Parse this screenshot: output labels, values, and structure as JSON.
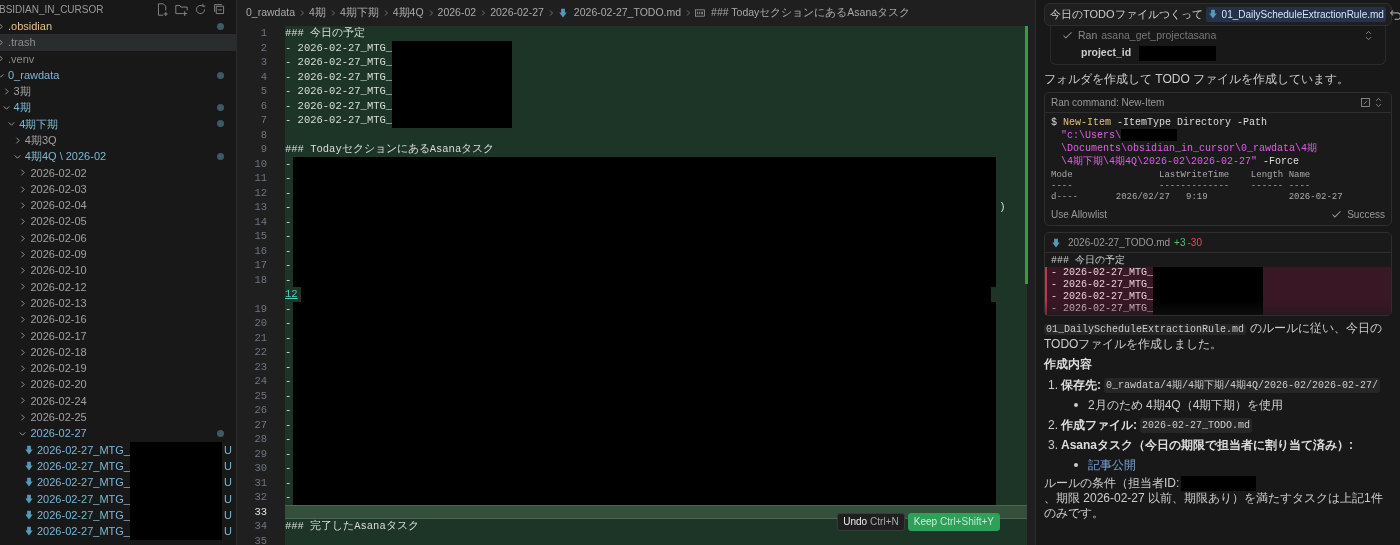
{
  "explorer": {
    "title": "BSIDIAN_IN_CURSOR",
    "tree": [
      {
        "name": ".obsidian",
        "kind": "folder",
        "expanded": false,
        "selected": false,
        "color": "#e2c08d",
        "modified": true
      },
      {
        "name": ".trash",
        "kind": "folder",
        "expanded": false,
        "selected": true,
        "color": "#8c8c8c",
        "modified": false
      },
      {
        "name": ".venv",
        "kind": "folder",
        "expanded": false,
        "selected": false,
        "color": "#8c8c8c",
        "modified": false
      },
      {
        "name": "0_rawdata",
        "kind": "folder",
        "expanded": true,
        "selected": false,
        "color": "#7ab8d6",
        "modified": true,
        "children": [
          {
            "name": "3期",
            "kind": "folder",
            "expanded": false,
            "selected": false,
            "color": "#a0a0a0",
            "modified": false
          },
          {
            "name": "4期",
            "kind": "folder",
            "expanded": true,
            "selected": false,
            "color": "#7ab8d6",
            "modified": true,
            "children": [
              {
                "name": "4期下期",
                "kind": "folder",
                "expanded": true,
                "selected": false,
                "color": "#7ab8d6",
                "modified": true,
                "children": [
                  {
                    "name": "4期3Q",
                    "kind": "folder",
                    "expanded": false,
                    "selected": false,
                    "color": "#a0a0a0",
                    "modified": false
                  },
                  {
                    "name": "4期4Q \\ 2026-02",
                    "kind": "folder",
                    "expanded": true,
                    "selected": false,
                    "color": "#7ab8d6",
                    "modified": true,
                    "children": [
                      {
                        "name": "2026-02-02",
                        "kind": "folder",
                        "expanded": false,
                        "selected": false,
                        "color": "#a0a0a0",
                        "modified": false
                      },
                      {
                        "name": "2026-02-03",
                        "kind": "folder",
                        "expanded": false,
                        "selected": false,
                        "color": "#a0a0a0",
                        "modified": false
                      },
                      {
                        "name": "2026-02-04",
                        "kind": "folder",
                        "expanded": false,
                        "selected": false,
                        "color": "#a0a0a0",
                        "modified": false
                      },
                      {
                        "name": "2026-02-05",
                        "kind": "folder",
                        "expanded": false,
                        "selected": false,
                        "color": "#a0a0a0",
                        "modified": false
                      },
                      {
                        "name": "2026-02-06",
                        "kind": "folder",
                        "expanded": false,
                        "selected": false,
                        "color": "#a0a0a0",
                        "modified": false
                      },
                      {
                        "name": "2026-02-09",
                        "kind": "folder",
                        "expanded": false,
                        "selected": false,
                        "color": "#a0a0a0",
                        "modified": false
                      },
                      {
                        "name": "2026-02-10",
                        "kind": "folder",
                        "expanded": false,
                        "selected": false,
                        "color": "#a0a0a0",
                        "modified": false
                      },
                      {
                        "name": "2026-02-12",
                        "kind": "folder",
                        "expanded": false,
                        "selected": false,
                        "color": "#a0a0a0",
                        "modified": false
                      },
                      {
                        "name": "2026-02-13",
                        "kind": "folder",
                        "expanded": false,
                        "selected": false,
                        "color": "#a0a0a0",
                        "modified": false
                      },
                      {
                        "name": "2026-02-16",
                        "kind": "folder",
                        "expanded": false,
                        "selected": false,
                        "color": "#a0a0a0",
                        "modified": false
                      },
                      {
                        "name": "2026-02-17",
                        "kind": "folder",
                        "expanded": false,
                        "selected": false,
                        "color": "#a0a0a0",
                        "modified": false
                      },
                      {
                        "name": "2026-02-18",
                        "kind": "folder",
                        "expanded": false,
                        "selected": false,
                        "color": "#a0a0a0",
                        "modified": false
                      },
                      {
                        "name": "2026-02-19",
                        "kind": "folder",
                        "expanded": false,
                        "selected": false,
                        "color": "#a0a0a0",
                        "modified": false
                      },
                      {
                        "name": "2026-02-20",
                        "kind": "folder",
                        "expanded": false,
                        "selected": false,
                        "color": "#a0a0a0",
                        "modified": false
                      },
                      {
                        "name": "2026-02-24",
                        "kind": "folder",
                        "expanded": false,
                        "selected": false,
                        "color": "#a0a0a0",
                        "modified": false
                      },
                      {
                        "name": "2026-02-25",
                        "kind": "folder",
                        "expanded": false,
                        "selected": false,
                        "color": "#a0a0a0",
                        "modified": false
                      },
                      {
                        "name": "2026-02-27",
                        "kind": "folder",
                        "expanded": true,
                        "selected": false,
                        "color": "#7ab8d6",
                        "modified": true,
                        "children": [
                          {
                            "name": "2026-02-27_MTG_",
                            "kind": "file",
                            "selected": false,
                            "color": "#7ab8d6",
                            "modified": false,
                            "status": "U",
                            "redacted": true
                          },
                          {
                            "name": "2026-02-27_MTG_",
                            "kind": "file",
                            "selected": false,
                            "color": "#7ab8d6",
                            "modified": false,
                            "status": "U",
                            "redacted": true
                          },
                          {
                            "name": "2026-02-27_MTG_",
                            "kind": "file",
                            "selected": false,
                            "color": "#7ab8d6",
                            "modified": false,
                            "status": "U",
                            "redacted": true
                          },
                          {
                            "name": "2026-02-27_MTG_",
                            "kind": "file",
                            "selected": false,
                            "color": "#7ab8d6",
                            "modified": false,
                            "status": "U",
                            "redacted": true
                          },
                          {
                            "name": "2026-02-27_MTG_",
                            "kind": "file",
                            "selected": false,
                            "color": "#7ab8d6",
                            "modified": false,
                            "status": "U",
                            "redacted": true
                          },
                          {
                            "name": "2026-02-27_MTG_",
                            "kind": "file",
                            "selected": false,
                            "color": "#7ab8d6",
                            "modified": false,
                            "status": "U",
                            "redacted": true
                          }
                        ]
                      }
                    ]
                  }
                ]
              }
            ]
          }
        ]
      }
    ]
  },
  "editor": {
    "breadcrumb": [
      {
        "text": "0_rawdata",
        "kind": "folder"
      },
      {
        "text": "4期",
        "kind": "folder"
      },
      {
        "text": "4期下期",
        "kind": "folder"
      },
      {
        "text": "4期4Q",
        "kind": "folder"
      },
      {
        "text": "2026-02",
        "kind": "folder"
      },
      {
        "text": "2026-02-27",
        "kind": "folder"
      },
      {
        "text": "2026-02-27_TODO.md",
        "kind": "file"
      },
      {
        "text": "### TodayセクションにあるAsanaタスク",
        "kind": "symbol"
      }
    ],
    "lines": [
      {
        "number": "1",
        "text": "### 今日の予定",
        "kind": "heading",
        "current": false
      },
      {
        "number": "2",
        "text": "- 2026-02-27_MTG_",
        "kind": "meeting",
        "current": false
      },
      {
        "number": "3",
        "text": "- 2026-02-27_MTG_",
        "kind": "meeting",
        "current": false
      },
      {
        "number": "4",
        "text": "- 2026-02-27_MTG_",
        "kind": "meeting",
        "current": false
      },
      {
        "number": "5",
        "text": "- 2026-02-27_MTG_",
        "kind": "meeting",
        "current": false
      },
      {
        "number": "6",
        "text": "- 2026-02-27_MTG_",
        "kind": "meeting",
        "current": false
      },
      {
        "number": "7",
        "text": "- 2026-02-27_MTG_",
        "kind": "meeting",
        "current": false
      },
      {
        "number": "8",
        "kind": "blank",
        "current": false
      },
      {
        "number": "9",
        "text": "### TodayセクションにあるAsanaタスク",
        "kind": "heading",
        "current": false
      },
      {
        "number": "10",
        "text": "-",
        "kind": "task",
        "current": false
      },
      {
        "number": "11",
        "text": "-",
        "kind": "task",
        "current": false
      },
      {
        "number": "12",
        "text": "-",
        "kind": "task",
        "current": false
      },
      {
        "number": "13",
        "text": "-",
        "kind": "task",
        "trailing": ")",
        "current": false
      },
      {
        "number": "14",
        "text": "-",
        "kind": "task",
        "current": false
      },
      {
        "number": "15",
        "text": "-",
        "kind": "task",
        "current": false
      },
      {
        "number": "16",
        "text": "-",
        "kind": "task",
        "current": false
      },
      {
        "number": "17",
        "text": "-",
        "kind": "task",
        "current": false
      },
      {
        "number": "18",
        "text": "-",
        "kind": "task",
        "current": false
      },
      {
        "text": "12",
        "kind": "annotation",
        "current": false
      },
      {
        "number": "19",
        "text": "-",
        "kind": "task",
        "current": false
      },
      {
        "number": "20",
        "text": "-",
        "kind": "task",
        "current": false
      },
      {
        "number": "21",
        "text": "-",
        "kind": "task",
        "current": false
      },
      {
        "number": "22",
        "text": "-",
        "kind": "task",
        "current": false
      },
      {
        "number": "23",
        "text": "-",
        "kind": "task",
        "current": false
      },
      {
        "number": "24",
        "text": "-",
        "kind": "task",
        "current": false
      },
      {
        "number": "25",
        "text": "-",
        "kind": "task",
        "current": false
      },
      {
        "number": "26",
        "text": "-",
        "kind": "task",
        "current": false
      },
      {
        "number": "27",
        "text": "-",
        "kind": "task",
        "current": false
      },
      {
        "number": "28",
        "text": "-",
        "kind": "task",
        "current": false
      },
      {
        "number": "29",
        "text": "-",
        "kind": "task",
        "current": false
      },
      {
        "number": "30",
        "text": "-",
        "kind": "task",
        "current": false
      },
      {
        "number": "31",
        "text": "-",
        "kind": "task",
        "current": false
      },
      {
        "number": "32",
        "text": "-",
        "kind": "task",
        "current": false
      },
      {
        "number": "33",
        "kind": "blank",
        "current": true
      },
      {
        "number": "34",
        "text": "### 完了したAsanaタスク",
        "kind": "heading",
        "current": false
      },
      {
        "number": "35",
        "kind": "blank",
        "current": false
      }
    ],
    "actions": [
      {
        "label": "Undo",
        "shortcut": "Ctrl+N",
        "kind": "secondary"
      },
      {
        "label": "Keep",
        "shortcut": "Ctrl+Shift+Y",
        "kind": "primary"
      }
    ]
  },
  "chat": {
    "prompt": {
      "text": "今日のTODOファイルつくって",
      "attachment": "01_DailyScheduleExtractionRule.md"
    },
    "tool_call": {
      "verb": "Ran",
      "tool": "asana_get_projectasana",
      "param": "project_id"
    },
    "status_text": "フォルダを作成して TODO ファイルを作成しています。",
    "command": {
      "title": "Ran command: New-Item",
      "lines": [
        [
          {
            "text": "$",
            "kind": "prompt"
          },
          {
            "text": "New-Item",
            "kind": "cmdlet"
          },
          {
            "text": "-ItemType Directory -Path",
            "kind": "arg"
          }
        ],
        [
          {
            "text": "\"c:\\Users\\",
            "kind": "string"
          },
          {
            "kind": "redaction"
          },
          {
            "text": "\\Documents\\obsidian_in_cursor\\0_rawdata\\4期",
            "kind": "string"
          }
        ],
        [
          {
            "text": "\\4期下期\\4期4Q\\2026-02\\2026-02-27\"",
            "kind": "string"
          },
          {
            "text": "-Force",
            "kind": "arg"
          }
        ]
      ],
      "output": [
        "Mode                LastWriteTime    Length Name",
        "----                -------------    ------ ----",
        "d----       2026/02/27   9:19               2026-02-27"
      ],
      "allowlist": "Use Allowlist",
      "result": "Success"
    },
    "diff": {
      "file": "2026-02-27_TODO.md",
      "added": "+3",
      "removed": "-30",
      "lines": [
        {
          "text": "### 今日の予定",
          "kind": "context"
        },
        {
          "text": "- 2026-02-27_MTG_",
          "kind": "removed"
        },
        {
          "text": "- 2026-02-27_MTG_",
          "kind": "removed"
        },
        {
          "text": "- 2026-02-27_MTG_",
          "kind": "removed"
        },
        {
          "text": "- 2026-02-27_MTG_",
          "kind": "removed"
        }
      ]
    },
    "summary": {
      "code": "01_DailyScheduleExtractionRule.md",
      "text": "のルールに従い、今日のTODOファイルを作成しました。"
    },
    "heading": "作成内容",
    "items": [
      {
        "number": "1.",
        "label": "保存先:",
        "code": "0_rawdata/4期/4期下期/4期4Q/2026-02/2026-02-27/",
        "bullets": [
          {
            "text": "2月のため 4期4Q（4期下期）を使用",
            "kind": "text"
          }
        ]
      },
      {
        "number": "2.",
        "label": "作成ファイル:",
        "code": "2026-02-27_TODO.md"
      },
      {
        "number": "3.",
        "label": "Asanaタスク（今日の期限で担当者に割り当て済み）:",
        "bullets": [
          {
            "text": "記事公開",
            "kind": "link"
          }
        ]
      }
    ],
    "conclusion": {
      "before": "ルールの条件（担当者ID:",
      "after": "、期限 2026-02-27 以前、期限あり）を満たすタスクは上記1件のみです。"
    }
  }
}
